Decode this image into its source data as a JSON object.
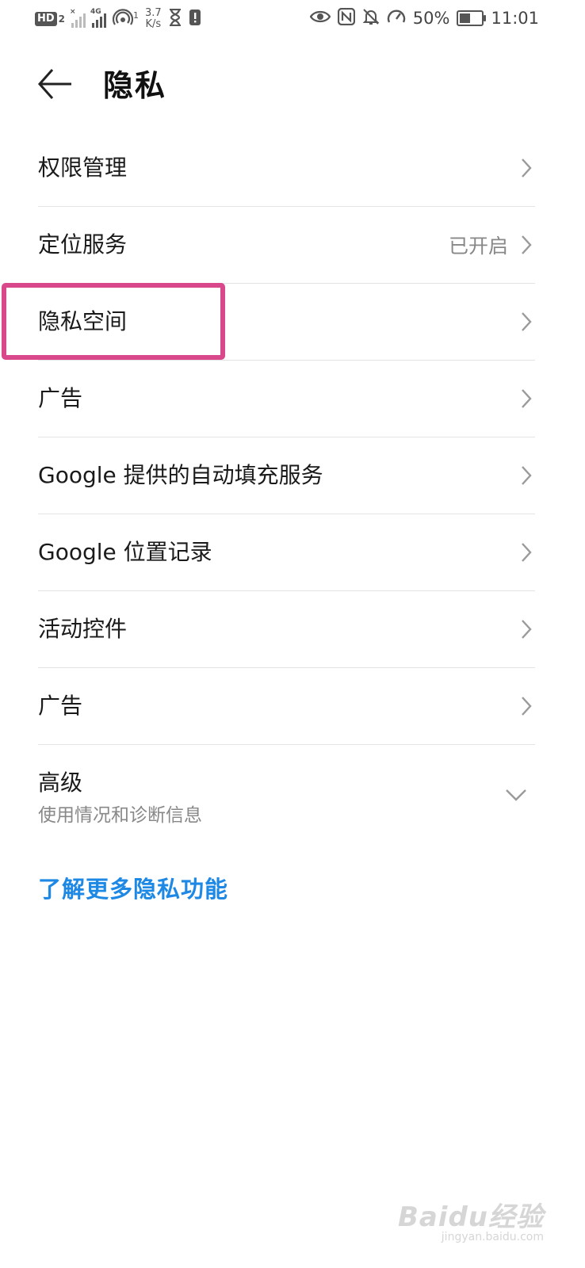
{
  "status_bar": {
    "hd_label": "HD",
    "hd_sim": "2",
    "network_type": "4G",
    "wifi_sup": "1",
    "net_speed_value": "3.7",
    "net_speed_unit": "K/s",
    "battery_percent": "50%",
    "battery_level": 0.5,
    "time": "11:01",
    "icons": [
      "hd-icon",
      "signal-x-icon",
      "signal-4g-icon",
      "hotspot-icon",
      "hourglass-icon",
      "alert-icon",
      "eye-icon",
      "nfc-icon",
      "mute-icon",
      "speed-icon",
      "battery-icon"
    ]
  },
  "header": {
    "title": "隐私"
  },
  "items": [
    {
      "label": "权限管理",
      "value": ""
    },
    {
      "label": "定位服务",
      "value": "已开启"
    },
    {
      "label": "隐私空间",
      "value": ""
    },
    {
      "label": "广告",
      "value": ""
    },
    {
      "label": "Google 提供的自动填充服务",
      "value": ""
    },
    {
      "label": "Google 位置记录",
      "value": ""
    },
    {
      "label": "活动控件",
      "value": ""
    },
    {
      "label": "广告",
      "value": ""
    }
  ],
  "advanced": {
    "title": "高级",
    "subtitle": "使用情况和诊断信息"
  },
  "more_link": "了解更多隐私功能",
  "colors": {
    "link": "#1e88e5",
    "highlight": "#d9488a"
  },
  "watermark": {
    "text": "Baidu经验",
    "sub": "jingyan.baidu.com"
  }
}
